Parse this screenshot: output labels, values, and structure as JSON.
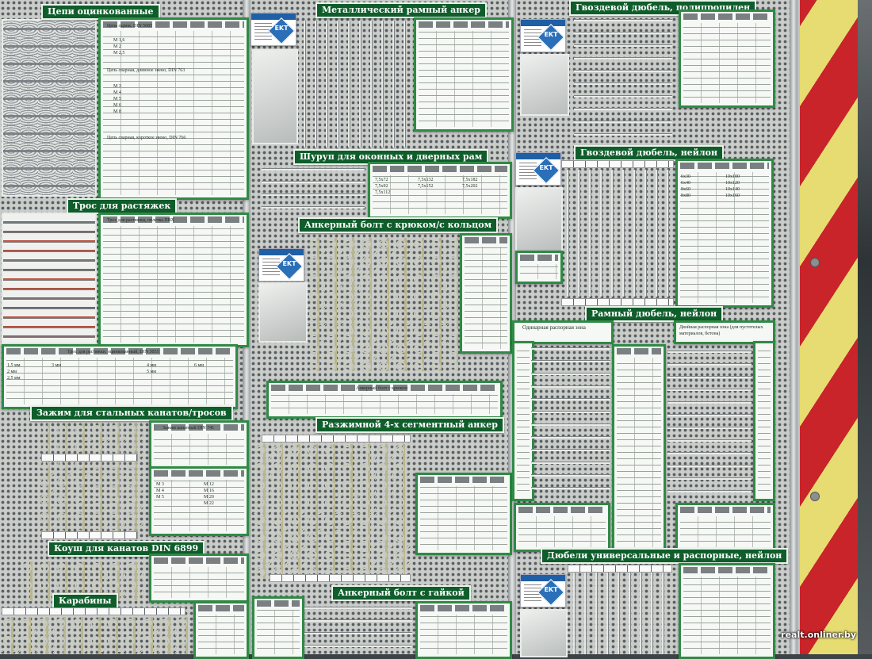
{
  "headers": {
    "chains": "Цепи оцинкованные",
    "frame_anchor": "Металлический рамный анкер",
    "nail_dowel_pp": "Гвоздевой дюбель, полипропилен",
    "window_screw": "Шуруп для оконных и дверных рам",
    "nail_dowel_nylon": "Гвоздевой дюбель, нейлон",
    "hook_anchor": "Анкерный болт с крюком/с кольцом",
    "tension_rope": "Трос для растяжек",
    "frame_dowel_nylon": "Рамный дюбель, нейлон",
    "cable_clamp": "Зажим для стальных канатов/тросов",
    "segment_anchor": "Разжимной 4-х сегментный анкер",
    "thimble": "Коуш для канатов DIN 6899",
    "carabiners": "Карабины",
    "nut_anchor": "Анкерный болт с гайкой",
    "universal_dowel": "Дюбели универсальные и распорные, нейлон"
  },
  "table_captions": {
    "chain_din5685": "Цепь оцинк. DIN 5685",
    "chain_din763": "Цепь сварная, длинное звено, DIN 763",
    "chain_din766": "Цепь сварная, короткое звено, DIN 766",
    "rope_pvc": "Трос для растяжки, оплетка ПВХ",
    "rope_din3055": "Трос для растяжки, оцинкованный, DIN 3055",
    "clamp_din741": "Зажим канатный DIN 741",
    "single_zone": "Одинарная распорная зона",
    "double_zone": "Двойная распорная зона (для пустотелых материалов, бетона)",
    "hook_anchor_table": "Анкерный болт с крюком"
  },
  "size_samples": {
    "chain_sizes": [
      "М 1,6",
      "М 2",
      "М 2,5",
      "М 3",
      "М 4",
      "М 5",
      "М 6",
      "М 8"
    ],
    "screw_sizes": [
      "7,5x72",
      "7,5x92",
      "7,5x112",
      "7,5x132",
      "7,5x152",
      "7,5x182",
      "7,5x202"
    ],
    "dowel_sizes": [
      "6x30",
      "6x40",
      "8x60",
      "8x80",
      "10x100",
      "10x120",
      "10x140",
      "10x160"
    ],
    "rope_sizes": [
      "1,5 мм",
      "2 мм",
      "2,5 мм",
      "3 мм",
      "4 мм",
      "5 мм",
      "6 мм"
    ],
    "clamp_sizes": [
      "М 3",
      "М 4",
      "М 5",
      "М 6",
      "М 8",
      "М 10",
      "М 12",
      "М 16",
      "М 20",
      "М 22"
    ]
  },
  "table_columns": [
    "Размер",
    "Стоимость"
  ],
  "brand": "EKT",
  "watermark": "realt.onliner.by",
  "colors": {
    "header_green": "#0f5d2b",
    "table_border": "#2f8a45",
    "stripe_red": "#c9242a",
    "stripe_yellow": "#e6dc72",
    "brand_blue": "#1f5fa6"
  }
}
